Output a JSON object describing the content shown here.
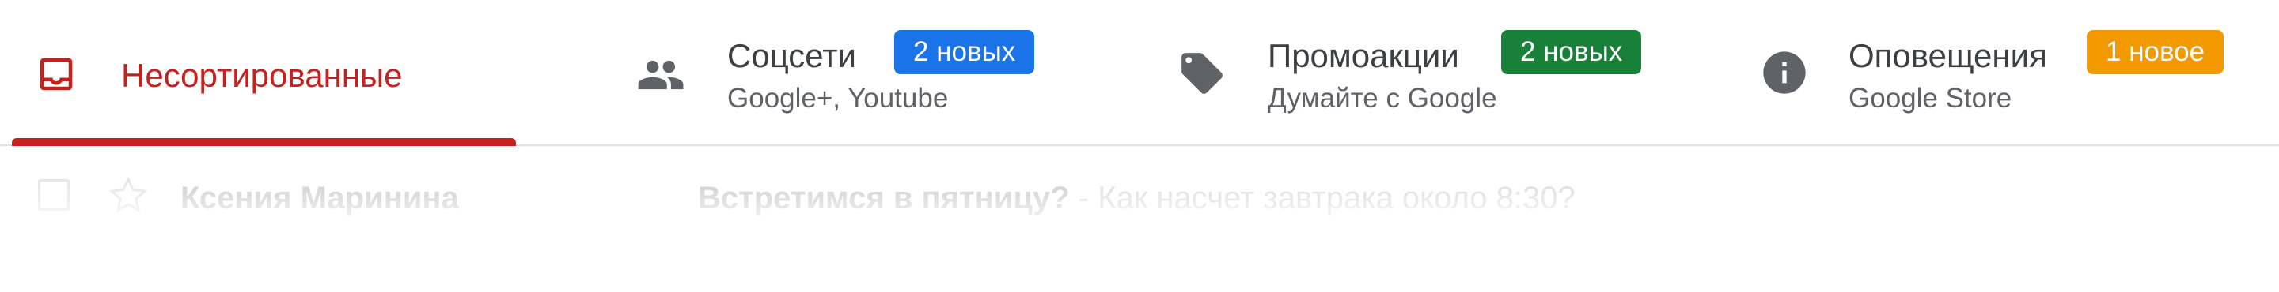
{
  "tabs": [
    {
      "title": "Несортированные",
      "subtitle": "",
      "badge": "",
      "icon": "inbox-icon",
      "active": true,
      "color": "#c5221f"
    },
    {
      "title": "Соцсети",
      "subtitle": "Google+, Youtube",
      "badge": "2 новых",
      "badge_color": "#1a73e8",
      "icon": "people-icon",
      "active": false
    },
    {
      "title": "Промоакции",
      "subtitle": "Думайте с Google",
      "badge": "2 новых",
      "badge_color": "#188038",
      "icon": "tag-icon",
      "active": false
    },
    {
      "title": "Оповещения",
      "subtitle": "Google Store",
      "badge": "1 новое",
      "badge_color": "#f29900",
      "icon": "info-icon",
      "active": false
    }
  ],
  "email": {
    "sender": "Ксения Маринина",
    "subject": "Встретимся в пятницу?",
    "separator": " - ",
    "snippet": "Как насчет завтрака около 8:30?"
  },
  "colors": {
    "active_tab": "#c5221f",
    "icon_gray": "#5f6368",
    "divider": "#e0e0e0"
  }
}
